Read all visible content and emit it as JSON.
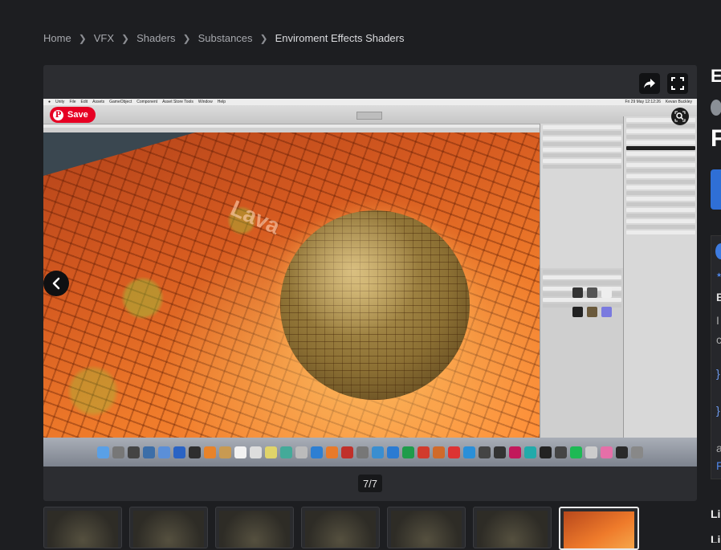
{
  "breadcrumb": {
    "items": [
      "Home",
      "VFX",
      "Shaders",
      "Substances"
    ],
    "current": "Enviroment Effects Shaders"
  },
  "viewer": {
    "counter": "7/7",
    "save_label": "Save",
    "pin_glyph": "P",
    "share_icon": "share-icon",
    "fullscreen_icon": "fullscreen-icon",
    "prev_icon": "chevron-left-icon",
    "lens_icon": "visual-search-icon"
  },
  "screenshot": {
    "scene_text": "Lava",
    "menu_items": [
      "Unity",
      "File",
      "Edit",
      "Assets",
      "GameObject",
      "Component",
      "Asset Store Tools",
      "Window",
      "Help"
    ],
    "status_time": "Fri 29 May  12:12:26",
    "status_user": "Kevan Buckley"
  },
  "thumbnails": [
    {
      "label": "image-1"
    },
    {
      "label": "image-2"
    },
    {
      "label": "image-3"
    },
    {
      "label": "image-4"
    },
    {
      "label": "image-5"
    },
    {
      "label": "image-6"
    },
    {
      "label": "image-7"
    }
  ],
  "sidebar_partial": {
    "title_initial": "E",
    "heading_initial": "F",
    "body_initials": [
      "B",
      "I",
      "c",
      "}",
      "}",
      "a",
      "F"
    ],
    "footer_initials": [
      "Li",
      "Li"
    ]
  },
  "colors": {
    "page_bg": "#1d1e21",
    "viewer_bg": "#2c2d31",
    "pinterest_red": "#e60023",
    "accent_blue": "#2f6fd6"
  }
}
